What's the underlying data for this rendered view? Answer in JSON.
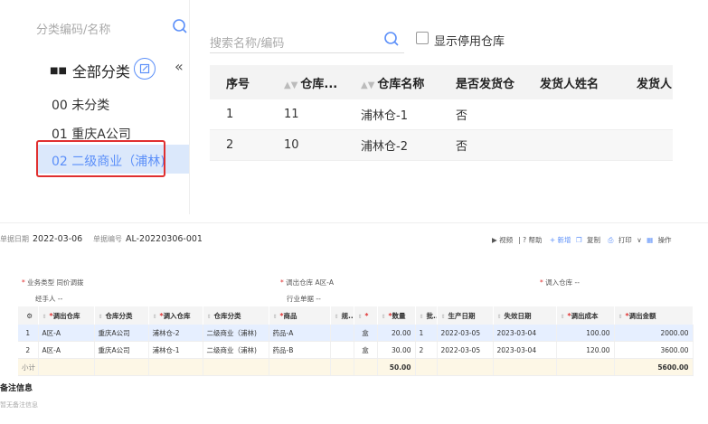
{
  "category_panel": {
    "search_placeholder": "分类编码/名称",
    "all_label": "全部分类",
    "collapse_glyph": "«",
    "items": [
      {
        "label": "00 未分类"
      },
      {
        "label": "01 重庆A公司"
      },
      {
        "label": "02 二级商业（浦林)",
        "selected": true
      }
    ]
  },
  "warehouse_panel": {
    "search_placeholder": "搜索名称/编码",
    "show_disabled_label": "显示停用仓库",
    "columns": [
      "序号",
      "仓库...",
      "仓库名称",
      "是否发货仓",
      "发货人姓名",
      "发货人"
    ],
    "rows": [
      [
        "1",
        "11",
        "浦林仓-1",
        "否",
        "",
        ""
      ],
      [
        "2",
        "10",
        "浦林仓-2",
        "否",
        "",
        ""
      ]
    ]
  },
  "document": {
    "date_label": "单据日期",
    "date_value": "2022-03-06",
    "number_label": "单据编号",
    "number_value": "AL-20220306-001",
    "toolbar": [
      "视频",
      "帮助",
      "+ 新增",
      "复制",
      "打印",
      "操作"
    ],
    "form": {
      "business_type_label": "业务类型",
      "business_type_value": "同价调拨",
      "handler_label": "经手人",
      "handler_value": "--",
      "out_wh_label": "调出仓库",
      "out_wh_value": "A区-A",
      "industry_doc_label": "行业单据",
      "industry_doc_value": "--",
      "in_wh_label": "调入仓库",
      "in_wh_value": "--"
    },
    "table": {
      "columns": [
        "调出仓库",
        "仓库分类",
        "调入仓库",
        "仓库分类",
        "商品",
        "规..",
        "",
        "数量",
        "批..",
        "生产日期",
        "失效日期",
        "调出成本",
        "调出金额"
      ],
      "required": [
        true,
        false,
        true,
        false,
        true,
        false,
        true,
        true,
        false,
        false,
        false,
        true,
        true
      ],
      "rows": [
        [
          "1",
          "A区-A",
          "重庆A公司",
          "浦林仓-2",
          "二级商业（浦林)",
          "药品-A",
          "",
          "盒",
          "20.00",
          "1",
          "2022-03-05",
          "2023-03-04",
          "100.00",
          "2000.00"
        ],
        [
          "2",
          "A区-A",
          "重庆A公司",
          "浦林仓-1",
          "二级商业（浦林)",
          "药品-B",
          "",
          "盒",
          "30.00",
          "2",
          "2022-03-05",
          "2023-03-04",
          "120.00",
          "3600.00"
        ]
      ],
      "summary_label": "小计",
      "summary_qty": "50.00",
      "summary_amount": "5600.00"
    },
    "notes_title": "备注信息",
    "notes_empty": "暂无备注信息"
  },
  "colors": {
    "accent": "#5b8ff9",
    "highlight": "#e03030",
    "selected_bg": "#dbe8fb"
  }
}
